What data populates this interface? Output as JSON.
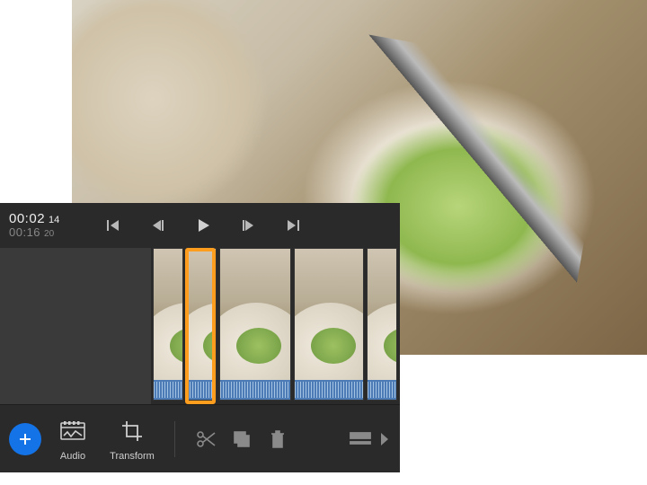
{
  "timecode": {
    "current_main": "00:02",
    "current_frames": "14",
    "duration_main": "00:16",
    "duration_frames": "20"
  },
  "transport": {
    "go_start": "go-to-start",
    "step_back": "step-back",
    "play": "play",
    "step_fwd": "step-forward",
    "go_end": "go-to-end"
  },
  "tools": {
    "add_label": "Add",
    "audio_label": "Audio",
    "transform_label": "Transform"
  },
  "colors": {
    "accent": "#1473e6",
    "playhead": "#ff9d1e",
    "audio_strip": "#4d7bb5"
  }
}
